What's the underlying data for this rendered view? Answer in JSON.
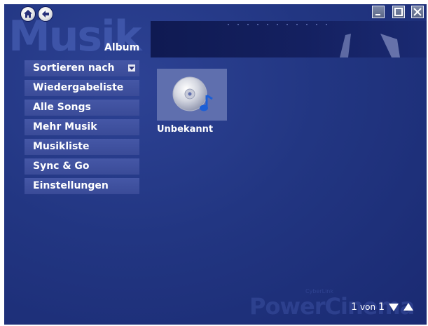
{
  "header": {
    "watermark": "Musik",
    "section": "Album"
  },
  "nav": {
    "home_icon": "home-icon",
    "back_icon": "back-arrow-icon"
  },
  "window_controls": {
    "minimize_icon": "minimize-icon",
    "maximize_icon": "maximize-icon",
    "close_icon": "close-icon"
  },
  "menu": {
    "items": [
      {
        "label": "Sortieren nach",
        "icon": "chevron-down-icon"
      },
      {
        "label": "Wiedergabeliste"
      },
      {
        "label": "Alle Songs"
      },
      {
        "label": "Mehr Musik"
      },
      {
        "label": "Musikliste"
      },
      {
        "label": "Sync & Go"
      },
      {
        "label": "Einstellungen"
      }
    ]
  },
  "albums": [
    {
      "label": "Unbekannt",
      "icon": "music-cd-icon"
    }
  ],
  "pager": {
    "current": "1",
    "separator": "von",
    "total": "1"
  },
  "branding": {
    "text": "PowerCinema",
    "small": "CyberLink"
  },
  "colors": {
    "background": "#223682",
    "menu_item": "#4557a6",
    "tile": "#5f6fae",
    "text": "#ffffff"
  }
}
